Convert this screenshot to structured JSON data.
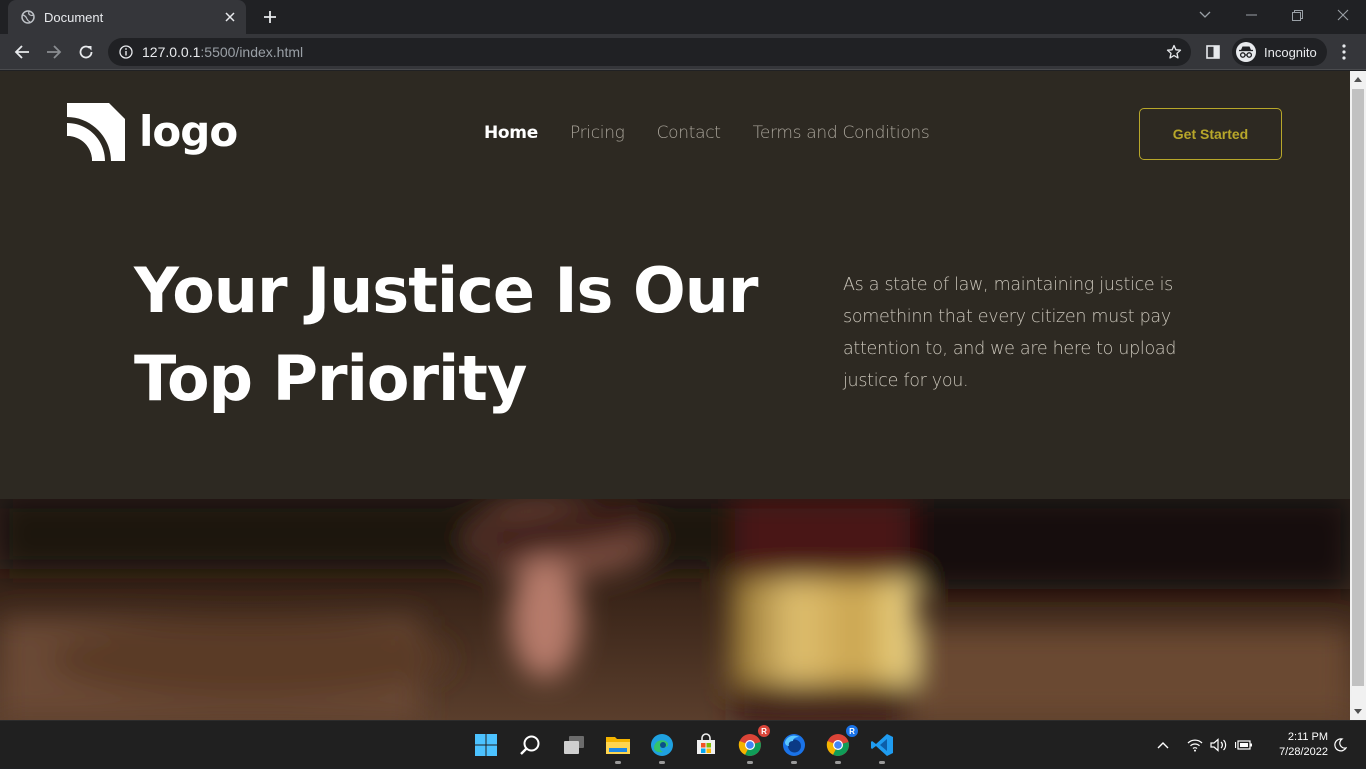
{
  "browser": {
    "tab_title": "Document",
    "url_host": "127.0.0.1",
    "url_path": ":5500/index.html",
    "profile_label": "Incognito"
  },
  "site": {
    "logo_text": "logo",
    "nav": [
      {
        "label": "Home",
        "active": true
      },
      {
        "label": "Pricing",
        "active": false
      },
      {
        "label": "Contact",
        "active": false
      },
      {
        "label": "Terms and Conditions",
        "active": false
      }
    ],
    "cta_label": "Get Started",
    "hero_title_line1": "Your Justice Is Our",
    "hero_title_line2": "Top Priority",
    "hero_text": "As a state of law, maintaining justice is somethinn that every citizen must pay attention to, and we are here to upload justice for you.",
    "colors": {
      "background": "#2d2922",
      "accent": "#b8a72a",
      "nav_inactive": "#a9a49a"
    }
  },
  "taskbar": {
    "time": "2:11 PM",
    "date": "7/28/2022",
    "apps": [
      "start-icon",
      "search-icon",
      "task-view-icon",
      "file-explorer-icon",
      "edge-icon",
      "store-icon",
      "chrome-icon",
      "firefox-icon",
      "chrome-icon",
      "vscode-icon"
    ]
  }
}
